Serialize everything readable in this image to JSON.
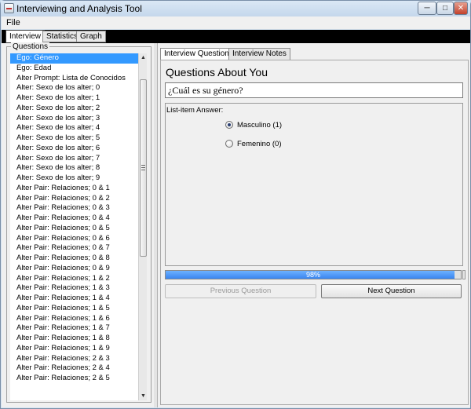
{
  "window": {
    "title": "Interviewing and Analysis Tool",
    "icons": {
      "app": "app-icon",
      "minimize": "minimize-icon",
      "maximize": "maximize-icon",
      "close": "close-icon"
    }
  },
  "menu": {
    "file": "File"
  },
  "main_tabs": [
    {
      "label": "Interview",
      "active": true
    },
    {
      "label": "Statistics",
      "active": false
    },
    {
      "label": "Graph",
      "active": false
    }
  ],
  "questions": {
    "legend": "Questions",
    "selected_index": 0,
    "items": [
      "Ego: Género",
      "Ego: Edad",
      "Alter Prompt: Lista de Conocidos",
      "Alter: Sexo de los alter; 0",
      "Alter: Sexo de los alter; 1",
      "Alter: Sexo de los alter; 2",
      "Alter: Sexo de los alter; 3",
      "Alter: Sexo de los alter; 4",
      "Alter: Sexo de los alter; 5",
      "Alter: Sexo de los alter; 6",
      "Alter: Sexo de los alter; 7",
      "Alter: Sexo de los alter; 8",
      "Alter: Sexo de los alter; 9",
      "Alter Pair: Relaciones; 0 & 1",
      "Alter Pair: Relaciones; 0 & 2",
      "Alter Pair: Relaciones; 0 & 3",
      "Alter Pair: Relaciones; 0 & 4",
      "Alter Pair: Relaciones; 0 & 5",
      "Alter Pair: Relaciones; 0 & 6",
      "Alter Pair: Relaciones; 0 & 7",
      "Alter Pair: Relaciones; 0 & 8",
      "Alter Pair: Relaciones; 0 & 9",
      "Alter Pair: Relaciones; 1 & 2",
      "Alter Pair: Relaciones; 1 & 3",
      "Alter Pair: Relaciones; 1 & 4",
      "Alter Pair: Relaciones; 1 & 5",
      "Alter Pair: Relaciones; 1 & 6",
      "Alter Pair: Relaciones; 1 & 7",
      "Alter Pair: Relaciones; 1 & 8",
      "Alter Pair: Relaciones; 1 & 9",
      "Alter Pair: Relaciones; 2 & 3",
      "Alter Pair: Relaciones; 2 & 4",
      "Alter Pair: Relaciones; 2 & 5"
    ]
  },
  "sub_tabs": [
    {
      "label": "Interview Questions",
      "active": true
    },
    {
      "label": "Interview Notes",
      "active": false
    }
  ],
  "interview": {
    "section_title": "Questions About You",
    "question_text": "¿Cuál es su género?",
    "answer_label": "List-item Answer:",
    "options": [
      {
        "label": "Masculino (1)",
        "selected": true
      },
      {
        "label": "Femenino (0)",
        "selected": false
      }
    ],
    "progress_percent": 98,
    "progress_text": "98%",
    "prev_button": "Previous Question",
    "next_button": "Next Question"
  },
  "colors": {
    "selection": "#3399ff",
    "progress": "#3a86f0",
    "tab_strip": "#000000"
  }
}
